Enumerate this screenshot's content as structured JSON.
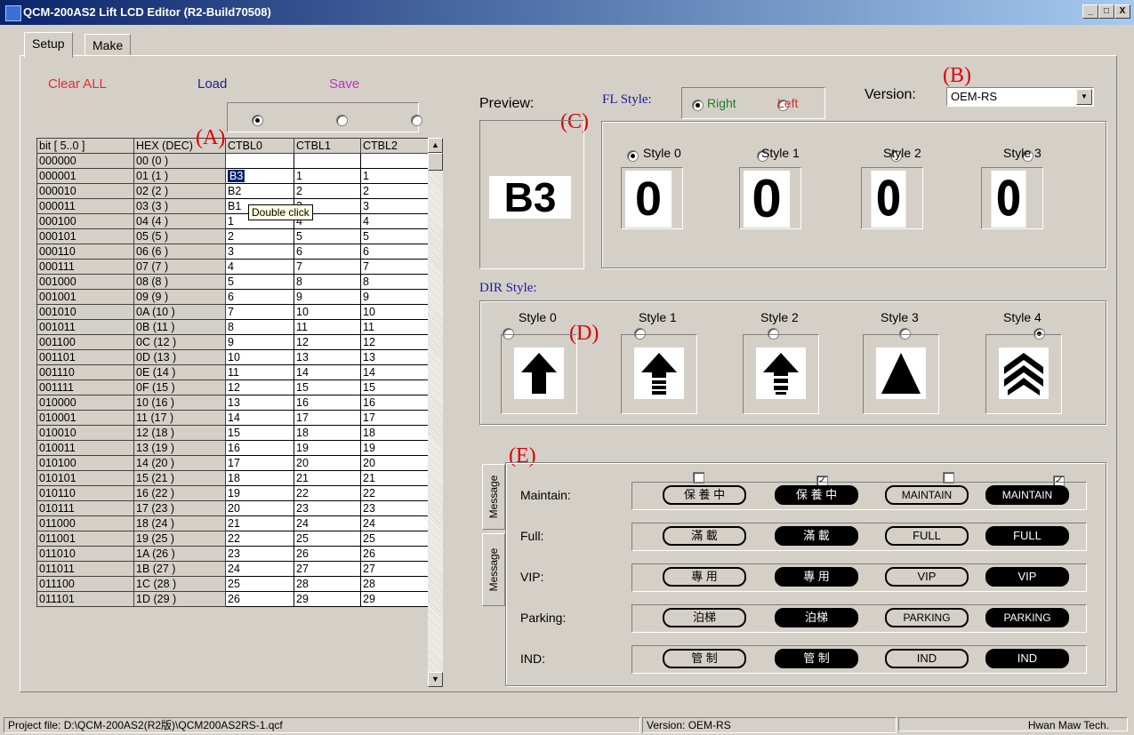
{
  "window": {
    "title": "QCM-200AS2 Lift LCD Editor (R2-Build70508)",
    "minimize": "_",
    "maximize": "□",
    "close": "X"
  },
  "tabs": [
    {
      "label": "Setup"
    },
    {
      "label": "Make"
    }
  ],
  "actions": {
    "clear_all": "Clear ALL",
    "load": "Load",
    "save": "Save"
  },
  "annotations": {
    "A": "(A)",
    "B": "(B)",
    "C": "(C)",
    "D": "(D)",
    "E": "(E)"
  },
  "table": {
    "headers": [
      "bit [ 5..0 ]",
      "HEX (DEC)",
      "CTBL0",
      "CTBL1",
      "CTBL2"
    ],
    "selected_column": 0,
    "rows": [
      [
        "000000",
        "00 (0 )",
        "",
        "",
        ""
      ],
      [
        "000001",
        "01 (1 )",
        "B3",
        "1",
        "1"
      ],
      [
        "000010",
        "02 (2 )",
        "B2",
        "2",
        "2"
      ],
      [
        "000011",
        "03 (3 )",
        "B1",
        "3",
        "3"
      ],
      [
        "000100",
        "04 (4 )",
        "1",
        "4",
        "4"
      ],
      [
        "000101",
        "05 (5 )",
        "2",
        "5",
        "5"
      ],
      [
        "000110",
        "06 (6 )",
        "3",
        "6",
        "6"
      ],
      [
        "000111",
        "07 (7 )",
        "4",
        "7",
        "7"
      ],
      [
        "001000",
        "08 (8 )",
        "5",
        "8",
        "8"
      ],
      [
        "001001",
        "09 (9 )",
        "6",
        "9",
        "9"
      ],
      [
        "001010",
        "0A (10 )",
        "7",
        "10",
        "10"
      ],
      [
        "001011",
        "0B (11 )",
        "8",
        "11",
        "11"
      ],
      [
        "001100",
        "0C (12 )",
        "9",
        "12",
        "12"
      ],
      [
        "001101",
        "0D (13 )",
        "10",
        "13",
        "13"
      ],
      [
        "001110",
        "0E (14 )",
        "11",
        "14",
        "14"
      ],
      [
        "001111",
        "0F (15 )",
        "12",
        "15",
        "15"
      ],
      [
        "010000",
        "10 (16 )",
        "13",
        "16",
        "16"
      ],
      [
        "010001",
        "11 (17 )",
        "14",
        "17",
        "17"
      ],
      [
        "010010",
        "12 (18 )",
        "15",
        "18",
        "18"
      ],
      [
        "010011",
        "13 (19 )",
        "16",
        "19",
        "19"
      ],
      [
        "010100",
        "14 (20 )",
        "17",
        "20",
        "20"
      ],
      [
        "010101",
        "15 (21 )",
        "18",
        "21",
        "21"
      ],
      [
        "010110",
        "16 (22 )",
        "19",
        "22",
        "22"
      ],
      [
        "010111",
        "17 (23 )",
        "20",
        "23",
        "23"
      ],
      [
        "011000",
        "18 (24 )",
        "21",
        "24",
        "24"
      ],
      [
        "011001",
        "19 (25 )",
        "22",
        "25",
        "25"
      ],
      [
        "011010",
        "1A (26 )",
        "23",
        "26",
        "26"
      ],
      [
        "011011",
        "1B (27 )",
        "24",
        "27",
        "27"
      ],
      [
        "011100",
        "1C (28 )",
        "25",
        "28",
        "28"
      ],
      [
        "011101",
        "1D (29 )",
        "26",
        "29",
        "29"
      ]
    ]
  },
  "tooltip": "Double click",
  "preview": {
    "label": "Preview:",
    "value": "B3"
  },
  "fl_style": {
    "label": "FL Style:",
    "right": "Right",
    "left": "Left",
    "selected": "Right"
  },
  "version": {
    "label": "Version:",
    "value": "OEM-RS"
  },
  "fl_styles": [
    {
      "label": "Style 0",
      "digit": "0",
      "selected": true
    },
    {
      "label": "Style 1",
      "digit": "0",
      "selected": false
    },
    {
      "label": "Style 2",
      "digit": "0",
      "selected": false
    },
    {
      "label": "Style 3",
      "digit": "0",
      "selected": false
    }
  ],
  "dir_style": {
    "label": "DIR Style:",
    "styles": [
      {
        "label": "Style 0",
        "icon": "arrow-up-icon",
        "selected": false
      },
      {
        "label": "Style 1",
        "icon": "arrow-up-dashed-icon",
        "selected": false
      },
      {
        "label": "Style 2",
        "icon": "arrow-up-dashed-icon",
        "selected": false
      },
      {
        "label": "Style 3",
        "icon": "triangle-up-icon",
        "selected": false
      },
      {
        "label": "Style 4",
        "icon": "double-chevron-up-icon",
        "selected": true
      }
    ]
  },
  "message_checks": [
    false,
    true,
    false,
    true
  ],
  "message_tabs": [
    "Message",
    "Message"
  ],
  "messages": [
    {
      "label": "Maintain:",
      "cells": [
        "保 養 中",
        "保 養 中",
        "MAINTAIN",
        "MAINTAIN"
      ]
    },
    {
      "label": "Full:",
      "cells": [
        "滿 載",
        "滿 載",
        "FULL",
        "FULL"
      ]
    },
    {
      "label": "VIP:",
      "cells": [
        "專 用",
        "專 用",
        "VIP",
        "VIP"
      ]
    },
    {
      "label": "Parking:",
      "cells": [
        "泊梯",
        "泊梯",
        "PARKING",
        "PARKING"
      ]
    },
    {
      "label": "IND:",
      "cells": [
        "管 制",
        "管 制",
        "IND",
        "IND"
      ]
    }
  ],
  "status": {
    "project": "Project file: D:\\QCM-200AS2(R2版)\\QCM200AS2RS-1.qcf",
    "version": "Version: OEM-RS",
    "company": "Hwan Maw Tech."
  },
  "colors": {
    "clear_all": "#e03030",
    "load": "#202090",
    "save": "#c030c0",
    "fl_right": "#208020",
    "fl_left": "#d03030",
    "annotation": "#e00000",
    "serif_label": "#1a1aa0"
  }
}
